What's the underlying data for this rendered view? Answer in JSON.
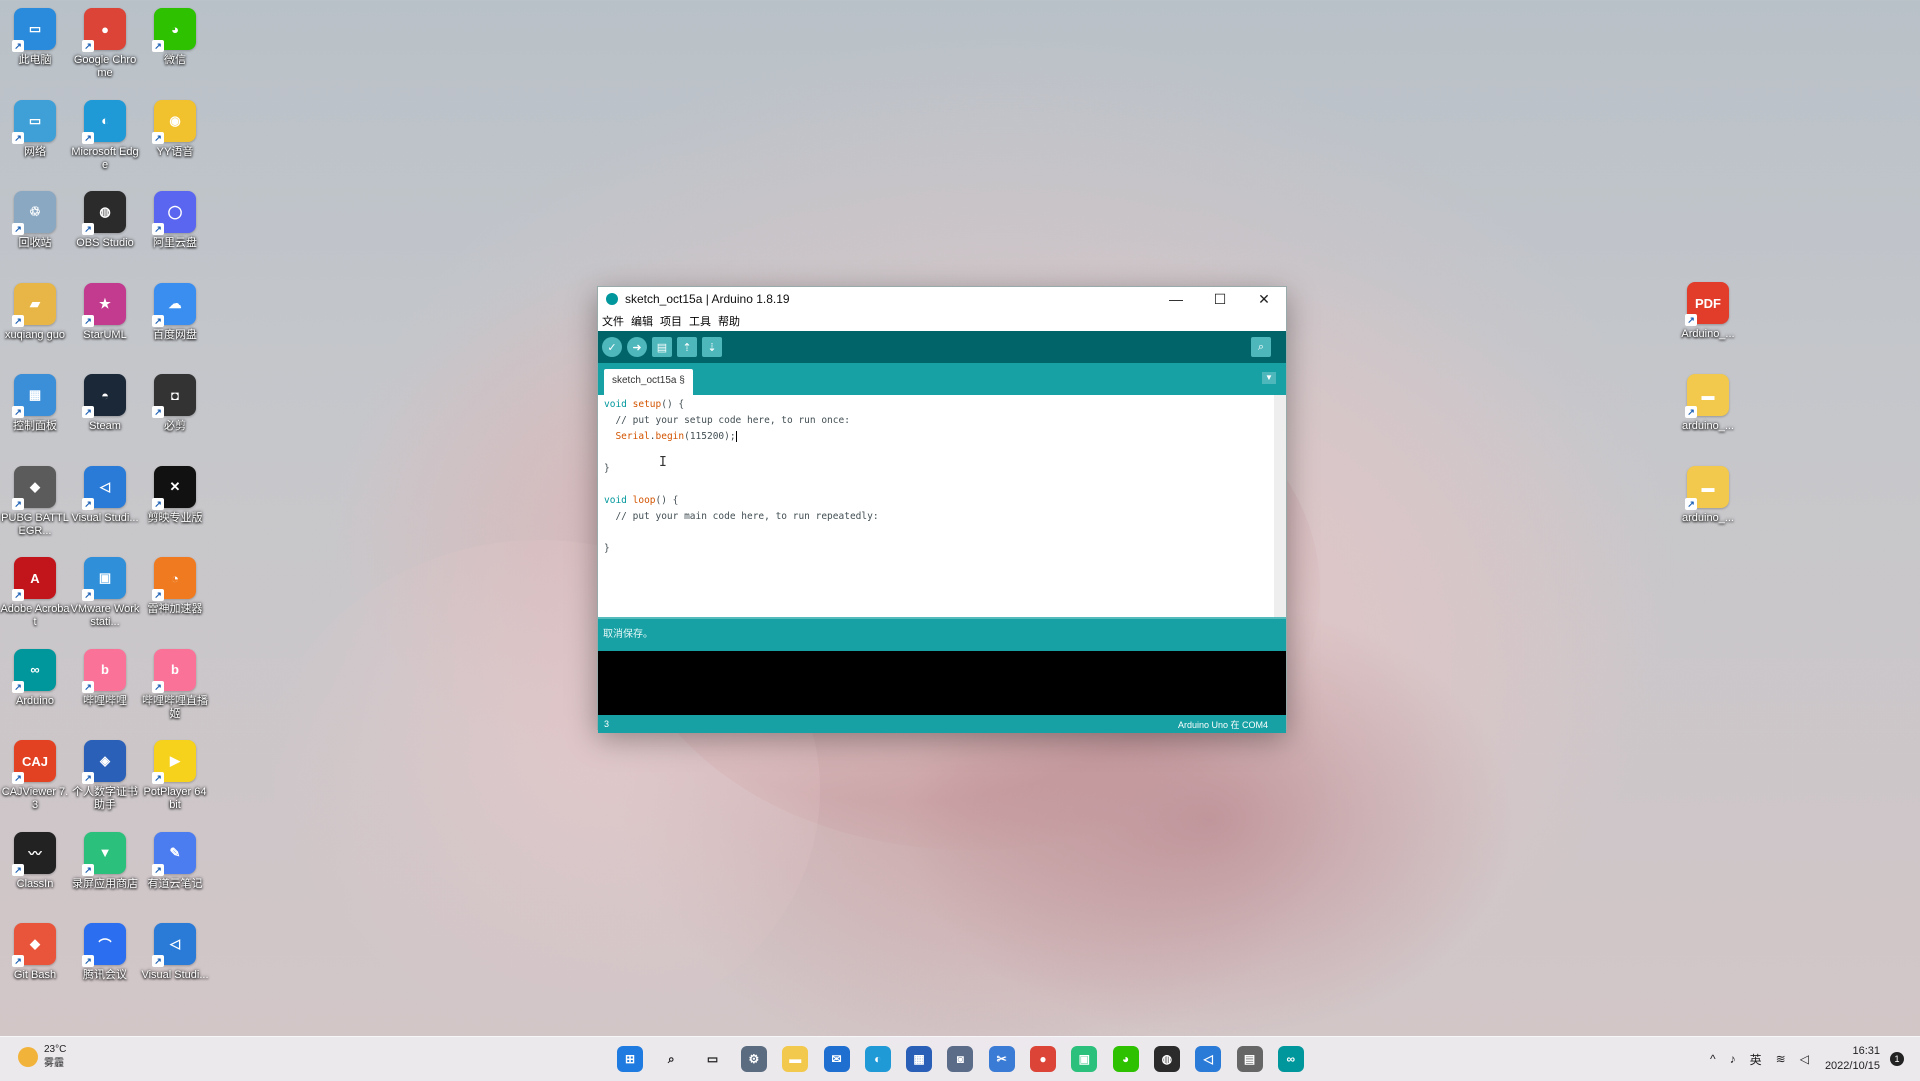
{
  "desktop": {
    "left_icons": [
      {
        "label": "此电脑",
        "glyph": "▭",
        "color": "#2a8bdc"
      },
      {
        "label": "Google Chrome",
        "glyph": "●",
        "color": "#db4437"
      },
      {
        "label": "微信",
        "glyph": "◕",
        "color": "#2dc100"
      },
      {
        "label": "网络",
        "glyph": "▭",
        "color": "#3fa0d8"
      },
      {
        "label": "Microsoft Edge",
        "glyph": "◐",
        "color": "#1f9ad6"
      },
      {
        "label": "YY语音",
        "glyph": "◉",
        "color": "#f2c12e"
      },
      {
        "label": "回收站",
        "glyph": "♲",
        "color": "#8aa8c2"
      },
      {
        "label": "OBS Studio",
        "glyph": "◍",
        "color": "#2b2b2b"
      },
      {
        "label": "阿里云盘",
        "glyph": "◯",
        "color": "#5a66f0"
      },
      {
        "label": "xuqiang guo",
        "glyph": "▰",
        "color": "#e8b646"
      },
      {
        "label": "StarUML",
        "glyph": "★",
        "color": "#c23b8f"
      },
      {
        "label": "百度网盘",
        "glyph": "☁",
        "color": "#3a8ef0"
      },
      {
        "label": "控制面板",
        "glyph": "▦",
        "color": "#3b8fd8"
      },
      {
        "label": "Steam",
        "glyph": "◓",
        "color": "#1b2838"
      },
      {
        "label": "必剪",
        "glyph": "◘",
        "color": "#333"
      },
      {
        "label": "PUBG BATTLEGR...",
        "glyph": "◆",
        "color": "#5b5b5b"
      },
      {
        "label": "Visual Studi...",
        "glyph": "◁",
        "color": "#2a7bd8"
      },
      {
        "label": "剪映专业版",
        "glyph": "✕",
        "color": "#111"
      },
      {
        "label": "Adobe Acrobat",
        "glyph": "A",
        "color": "#c2151b"
      },
      {
        "label": "VMware Workstati...",
        "glyph": "▣",
        "color": "#2f8fd8"
      },
      {
        "label": "雷神加速器",
        "glyph": "◔",
        "color": "#f07a20"
      },
      {
        "label": "Arduino",
        "glyph": "∞",
        "color": "#00979c"
      },
      {
        "label": "哔哩哔哩",
        "glyph": "b",
        "color": "#fb7299"
      },
      {
        "label": "哔哩哔哩直播姬",
        "glyph": "b",
        "color": "#fb7299"
      },
      {
        "label": "CAJViewer 7.3",
        "glyph": "CAJ",
        "color": "#e34222"
      },
      {
        "label": "个人数字证书助手",
        "glyph": "◈",
        "color": "#2a60b8"
      },
      {
        "label": "PotPlayer 64 bit",
        "glyph": "▶",
        "color": "#f6d21c"
      },
      {
        "label": "ClassIn",
        "glyph": "〰",
        "color": "#222"
      },
      {
        "label": "录屏应用商店",
        "glyph": "▼",
        "color": "#2bc07b"
      },
      {
        "label": "有道云笔记",
        "glyph": "✎",
        "color": "#4b7cf0"
      },
      {
        "label": "Git Bash",
        "glyph": "◆",
        "color": "#e9553b"
      },
      {
        "label": "腾讯会议",
        "glyph": "⌒",
        "color": "#2b6ff0"
      },
      {
        "label": "Visual Studi...",
        "glyph": "◁",
        "color": "#2a7bd8"
      }
    ],
    "right_icons": [
      {
        "label": "Arduino_...",
        "glyph": "PDF",
        "color": "#e23c2b"
      },
      {
        "label": "arduino_...",
        "glyph": "▬",
        "color": "#f2c94c"
      },
      {
        "label": "arduino_...",
        "glyph": "▬",
        "color": "#f2c94c"
      }
    ]
  },
  "window": {
    "title": "sketch_oct15a | Arduino 1.8.19",
    "minimize": "—",
    "maximize": "☐",
    "close": "✕",
    "menu": [
      "文件",
      "编辑",
      "项目",
      "工具",
      "帮助"
    ],
    "toolbar": {
      "verify": "✓",
      "upload": "➜",
      "new": "▤",
      "open": "⇡",
      "save": "⇣",
      "serial_monitor": "⌕"
    },
    "tab_label": "sketch_oct15a §",
    "tab_menu": "▼",
    "code": {
      "l1_kw": "void",
      "l1_fn": "setup",
      "l1_rest": "() {",
      "l2": "  // put your setup code here, to run once:",
      "l3_obj": "  Serial",
      "l3_dot": ".",
      "l3_fn": "begin",
      "l3_rest": "(115200);",
      "l5": "}",
      "l7_kw": "void",
      "l7_fn": "loop",
      "l7_rest": "() {",
      "l8": "  // put your main code here, to run repeatedly:",
      "l10": "}"
    },
    "status_message": "取消保存。",
    "line_number": "3",
    "board_port": "Arduino Uno 在 COM4"
  },
  "taskbar": {
    "weather_temp": "23°C",
    "weather_desc": "雾霾",
    "apps": [
      {
        "name": "start",
        "glyph": "⊞",
        "color": "#1f7be0"
      },
      {
        "name": "search",
        "glyph": "⌕",
        "color": "#333"
      },
      {
        "name": "task-view",
        "glyph": "▭",
        "color": "#333"
      },
      {
        "name": "settings",
        "glyph": "⚙",
        "color": "#5b6c80"
      },
      {
        "name": "file-explorer",
        "glyph": "▬",
        "color": "#f2c94c"
      },
      {
        "name": "mail",
        "glyph": "✉",
        "color": "#1f6fd0"
      },
      {
        "name": "edge",
        "glyph": "◐",
        "color": "#1f9ad6"
      },
      {
        "name": "store",
        "glyph": "▦",
        "color": "#2a5fb8"
      },
      {
        "name": "camera",
        "glyph": "◙",
        "color": "#5a6c88"
      },
      {
        "name": "snipping",
        "glyph": "✂",
        "color": "#3a7bd5"
      },
      {
        "name": "chrome",
        "glyph": "●",
        "color": "#db4437"
      },
      {
        "name": "green-app",
        "glyph": "▣",
        "color": "#2bc07b"
      },
      {
        "name": "wechat",
        "glyph": "◕",
        "color": "#2dc100"
      },
      {
        "name": "obs",
        "glyph": "◍",
        "color": "#2b2b2b"
      },
      {
        "name": "vscode",
        "glyph": "◁",
        "color": "#2a7bd8"
      },
      {
        "name": "tool",
        "glyph": "▤",
        "color": "#666"
      },
      {
        "name": "arduino",
        "glyph": "∞",
        "color": "#00979c"
      }
    ],
    "tray": {
      "chevron": "^",
      "mic": "♪",
      "ime": "英",
      "wifi": "≋",
      "volume": "◁",
      "time": "16:31",
      "date": "2022/10/15",
      "notifications": "1"
    }
  }
}
